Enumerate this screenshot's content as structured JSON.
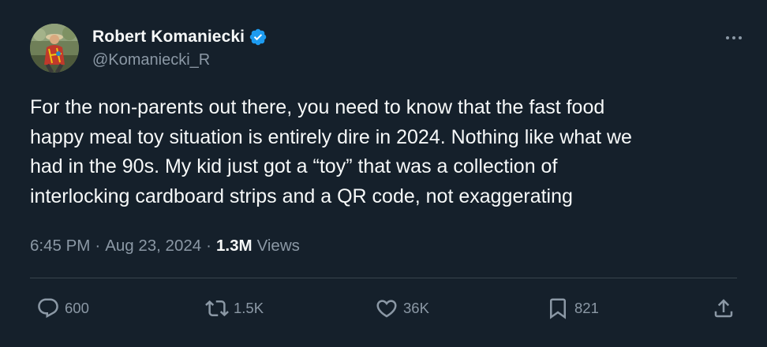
{
  "author": {
    "display_name": "Robert Komaniecki",
    "handle": "@Komaniecki_R",
    "verified": true
  },
  "tweet": {
    "text": "For the non-parents out there, you need to know that the fast food\nhappy meal toy situation is entirely dire in 2024. Nothing like what we\nhad in the 90s. My kid just got a “toy” that was a collection of\ninterlocking cardboard strips and a QR code, not exaggerating",
    "time": "6:45 PM",
    "separator": "·",
    "date": "Aug 23, 2024",
    "views_count": "1.3M",
    "views_label": "Views"
  },
  "actions": {
    "replies": "600",
    "retweets": "1.5K",
    "likes": "36K",
    "bookmarks": "821"
  },
  "icons": {
    "more": "more-icon",
    "verified": "verified-badge-icon",
    "reply": "reply-icon",
    "retweet": "retweet-icon",
    "like": "heart-icon",
    "bookmark": "bookmark-icon",
    "share": "share-icon"
  },
  "colors": {
    "background": "#15202b",
    "primary_text": "#f7f9f9",
    "secondary_text": "#8b98a5",
    "verified_blue": "#1d9bf0",
    "divider": "#38444d"
  }
}
